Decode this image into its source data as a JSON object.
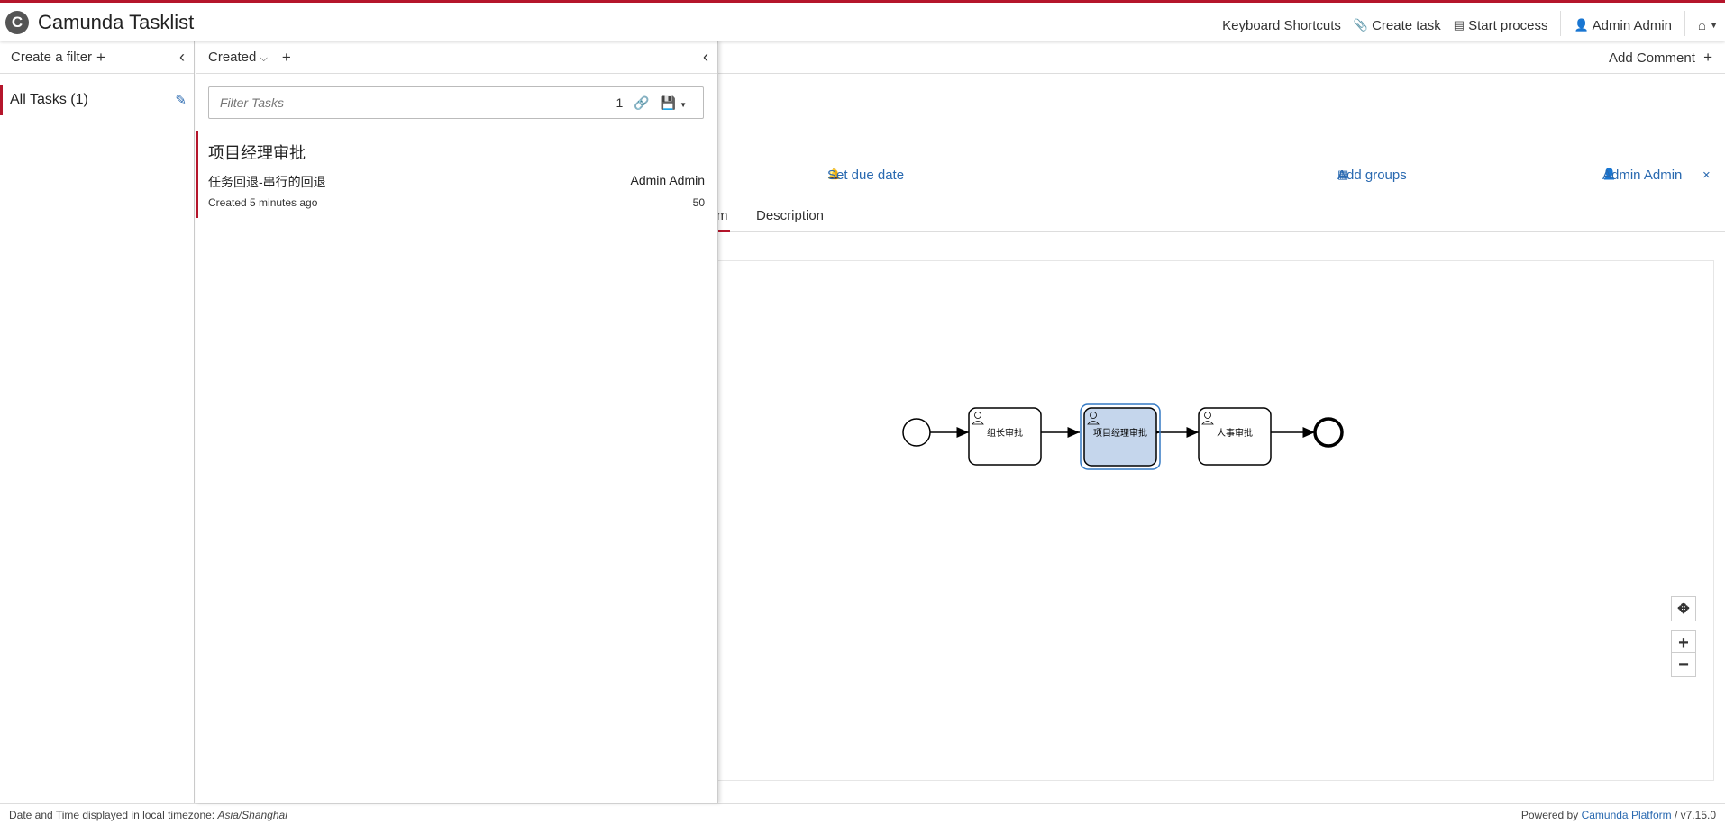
{
  "header": {
    "logo_letter": "C",
    "title": "Camunda Tasklist",
    "nav": {
      "keyboard_shortcuts": "Keyboard Shortcuts",
      "create_task": "Create task",
      "start_process": "Start process",
      "user": "Admin Admin"
    }
  },
  "filters": {
    "create_label": "Create a filter",
    "items": [
      {
        "label": "All Tasks (1)"
      }
    ]
  },
  "tasklist": {
    "sort_label": "Created",
    "filter_placeholder": "Filter Tasks",
    "filter_count": "1",
    "tasks": [
      {
        "name": "项目经理审批",
        "process": "任务回退-串行的回退",
        "assignee": "Admin Admin",
        "created": "Created 5 minutes ago",
        "priority": "50"
      }
    ]
  },
  "detail": {
    "add_comment": "Add Comment",
    "set_due_date": "Set due date",
    "add_groups": "Add groups",
    "assignee": "Admin Admin",
    "tabs": {
      "diagram_fragment": "m",
      "description": "Description"
    },
    "diagram": {
      "tasks": [
        "组长审批",
        "项目经理审批",
        "人事审批"
      ],
      "active_task": "项目经理审批"
    }
  },
  "footer": {
    "timezone_prefix": "Date and Time displayed in local timezone:",
    "timezone": "Asia/Shanghai",
    "powered_by": "Powered by",
    "platform": "Camunda Platform",
    "version": "/ v7.15.0"
  },
  "colors": {
    "accent": "#b5152b",
    "link": "#2969b0",
    "active_task_fill": "#c5d6ec",
    "active_task_stroke": "#3479c3"
  }
}
